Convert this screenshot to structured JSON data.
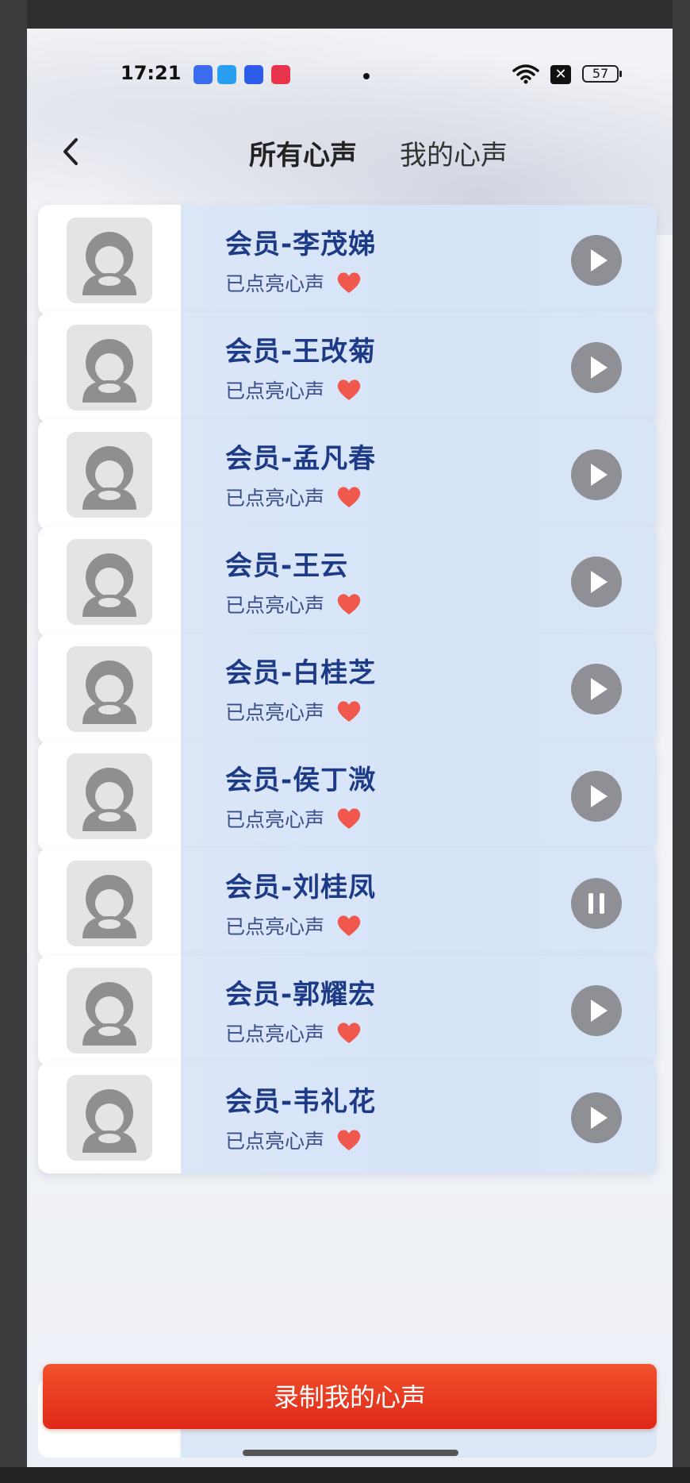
{
  "status_bar": {
    "time": "17:21",
    "battery": "57",
    "sim_label": "✕",
    "app_icon_colors": [
      "#3b6cf0",
      "#2a9ef0",
      "#2d5de8",
      "#e8344a"
    ]
  },
  "header": {
    "tabs": [
      {
        "label": "所有心声",
        "active": true
      },
      {
        "label": "我的心声",
        "active": false
      }
    ]
  },
  "members": [
    {
      "name": "会员-李茂娣",
      "status": "已点亮心声",
      "state": "play"
    },
    {
      "name": "会员-王改菊",
      "status": "已点亮心声",
      "state": "play"
    },
    {
      "name": "会员-孟凡春",
      "status": "已点亮心声",
      "state": "play"
    },
    {
      "name": "会员-王云",
      "status": "已点亮心声",
      "state": "play"
    },
    {
      "name": "会员-白桂芝",
      "status": "已点亮心声",
      "state": "play"
    },
    {
      "name": "会员-侯丁溦",
      "status": "已点亮心声",
      "state": "play"
    },
    {
      "name": "会员-刘桂凤",
      "status": "已点亮心声",
      "state": "pause"
    },
    {
      "name": "会员-郭耀宏",
      "status": "已点亮心声",
      "state": "play"
    },
    {
      "name": "会员-韦礼花",
      "status": "已点亮心声",
      "state": "play"
    }
  ],
  "record_button": {
    "label": "录制我的心声"
  },
  "colors": {
    "accent": "#e8341c",
    "name_text": "#1d3a86",
    "heart": "#f0584e",
    "card_bg": "#d6e4f8"
  }
}
